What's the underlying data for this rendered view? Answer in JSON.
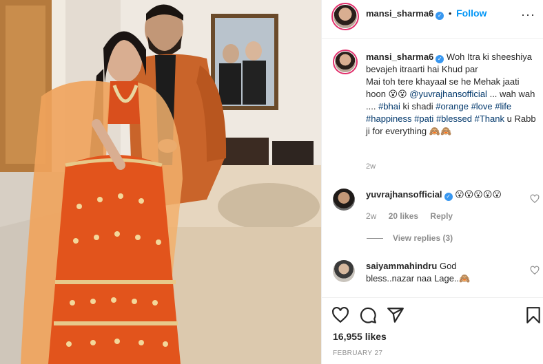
{
  "post": {
    "author": {
      "username": "mansi_sharma6",
      "verified": true,
      "verified_icon": "verified-badge-icon"
    },
    "header": {
      "separator": "•",
      "follow_label": "Follow",
      "more_icon": "more-options-icon",
      "more_glyph": "···"
    },
    "caption": {
      "username": "mansi_sharma6",
      "line1": "Woh Itra ki sheeshiya bevajeh itraarti hai Khud par",
      "line2": "Mai toh tere khayaal se he Mehak jaati hoon 😮😮",
      "mention": "@yuvrajhansofficial",
      "mid": "... wah wah ....",
      "hashtags": [
        "#bhai",
        "ki shadi",
        "#orange",
        "#love",
        "#life",
        "#happiness",
        "#pati",
        "#blessed",
        "#Thank",
        "u Rabb ji for everything 🙈🙈"
      ],
      "time": "2w"
    },
    "comments": [
      {
        "username": "yuvrajhansofficial",
        "verified": true,
        "text": "😮😮😮😮😮",
        "time": "2w",
        "likes": "20 likes",
        "reply_label": "Reply",
        "view_replies": "View replies (3)"
      },
      {
        "username": "saiyammahindru",
        "verified": false,
        "text": "God bless..nazar naa Lage..🙈"
      }
    ],
    "actions": {
      "like_icon": "heart-icon",
      "comment_icon": "comment-icon",
      "share_icon": "share-icon",
      "save_icon": "bookmark-icon"
    },
    "likes": "16,955 likes",
    "date": "FEBRUARY 27"
  },
  "colors": {
    "link": "#00376b",
    "follow": "#0095f6",
    "verified": "#3897f0",
    "muted": "#8e8e8e",
    "story_ring": "#e1306c"
  }
}
